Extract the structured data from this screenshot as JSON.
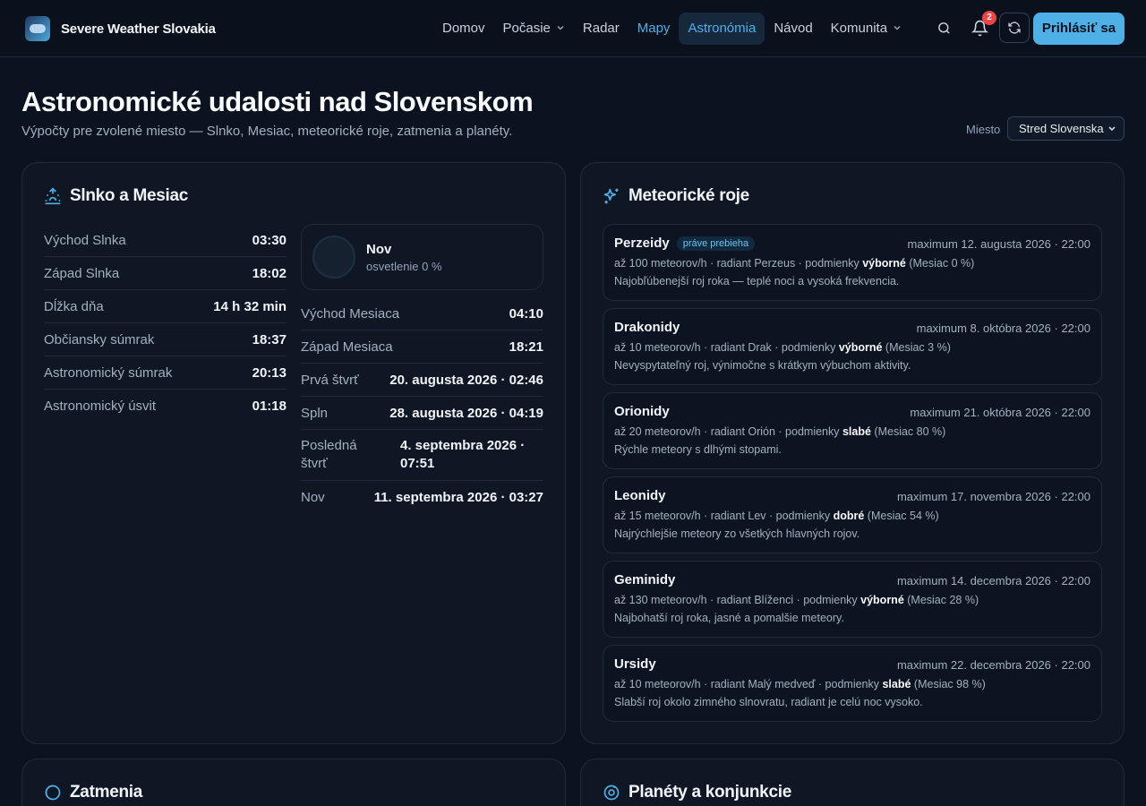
{
  "nav": {
    "brand": "Severe Weather Slovakia",
    "items": [
      {
        "label": "Domov"
      },
      {
        "label": "Počasie"
      },
      {
        "label": "Radar"
      },
      {
        "label": "Mapy"
      },
      {
        "label": "Astronómia"
      },
      {
        "label": "Návod"
      },
      {
        "label": "Komunita"
      }
    ],
    "notification_count": "2",
    "login_label": "Prihlásiť sa"
  },
  "header": {
    "title": "Astronomické udalosti nad Slovenskom",
    "subtitle": "Výpočty pre zvolené miesto — Slnko, Mesiac, meteorické roje, zatmenia a planéty.",
    "location_label": "Miesto",
    "location_value": "Stred Slovenska"
  },
  "sun_moon": {
    "title": "Slnko a Mesiac",
    "sun_rows": [
      {
        "label": "Východ Slnka",
        "value": "03:30"
      },
      {
        "label": "Západ Slnka",
        "value": "18:02"
      },
      {
        "label": "Dĺžka dňa",
        "value": "14 h 32 min"
      },
      {
        "label": "Občiansky súmrak",
        "value": "18:37"
      },
      {
        "label": "Astronomický súmrak",
        "value": "20:13"
      },
      {
        "label": "Astronomický úsvit",
        "value": "01:18"
      }
    ],
    "moon_phase": "Nov",
    "moon_illumination": "osvetlenie 0 %",
    "moon_rows": [
      {
        "label": "Východ Mesiaca",
        "value": "04:10"
      },
      {
        "label": "Západ Mesiaca",
        "value": "18:21"
      },
      {
        "label": "Prvá štvrť",
        "value": "20. augusta 2026 · 02:46"
      },
      {
        "label": "Spln",
        "value": "28. augusta 2026 · 04:19"
      },
      {
        "label": "Posledná štvrť",
        "value": "4. septembra 2026 · 07:51"
      },
      {
        "label": "Nov",
        "value": "11. septembra 2026 · 03:27"
      }
    ]
  },
  "meteors": {
    "title": "Meteorické roje",
    "showers": [
      {
        "name": "Perzeidy",
        "badge": "práve prebieha",
        "max": "maximum 12. augusta 2026 · 22:00",
        "pre": "až 100 meteorov/h · radiant Perzeus · podmienky ",
        "cond": "výborné",
        "moon": " (Mesiac 0 %)",
        "desc": "Najobľúbenejší roj roka — teplé noci a vysoká frekvencia."
      },
      {
        "name": "Drakonidy",
        "badge": "",
        "max": "maximum 8. októbra 2026 · 22:00",
        "pre": "až 10 meteorov/h · radiant Drak · podmienky ",
        "cond": "výborné",
        "moon": " (Mesiac 3 %)",
        "desc": "Nevyspytateľný roj, výnimočne s krátkym výbuchom aktivity."
      },
      {
        "name": "Orionidy",
        "badge": "",
        "max": "maximum 21. októbra 2026 · 22:00",
        "pre": "až 20 meteorov/h · radiant Orión · podmienky ",
        "cond": "slabé",
        "moon": " (Mesiac 80 %)",
        "desc": "Rýchle meteory s dlhými stopami."
      },
      {
        "name": "Leonidy",
        "badge": "",
        "max": "maximum 17. novembra 2026 · 22:00",
        "pre": "až 15 meteorov/h · radiant Lev · podmienky ",
        "cond": "dobré",
        "moon": " (Mesiac 54 %)",
        "desc": "Najrýchlejšie meteory zo všetkých hlavných rojov."
      },
      {
        "name": "Geminidy",
        "badge": "",
        "max": "maximum 14. decembra 2026 · 22:00",
        "pre": "až 130 meteorov/h · radiant Blíženci · podmienky ",
        "cond": "výborné",
        "moon": " (Mesiac 28 %)",
        "desc": "Najbohatší roj roka, jasné a pomalšie meteory."
      },
      {
        "name": "Ursidy",
        "badge": "",
        "max": "maximum 22. decembra 2026 · 22:00",
        "pre": "až 10 meteorov/h · radiant Malý medveď · podmienky ",
        "cond": "slabé",
        "moon": " (Mesiac 98 %)",
        "desc": "Slabší roj okolo zimného slnovratu, radiant je celú noc vysoko."
      }
    ]
  },
  "eclipses": {
    "title": "Zatmenia"
  },
  "planets": {
    "title": "Planéty a konjunkcie"
  },
  "colors": {
    "accent": "#4eb0e6",
    "background": "#0b1220",
    "card": "#0f1725",
    "badge": "#ef4444"
  },
  "icons": [
    "app-logo",
    "chevron-down-icon",
    "search-icon",
    "bell-icon",
    "refresh-icon",
    "sunrise-icon",
    "sparkles-icon",
    "eclipse-icon",
    "planet-icon"
  ]
}
